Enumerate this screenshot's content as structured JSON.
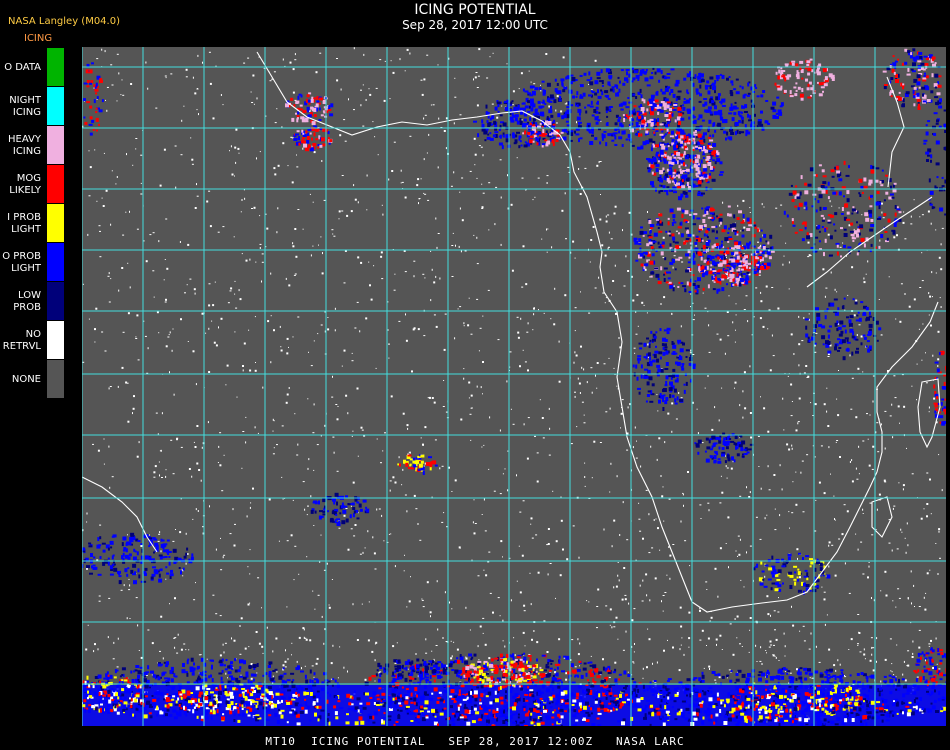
{
  "header": {
    "org": "NASA Langley (M04.0)",
    "variable": "ICING",
    "title": "ICING POTENTIAL",
    "datetime": "Sep 28, 2017 12:00 UTC"
  },
  "legend": [
    {
      "label": "O DATA",
      "color": "#00b400"
    },
    {
      "label": "NIGHT\nICING",
      "color": "#00ffff"
    },
    {
      "label": "HEAVY\nICING",
      "color": "#f0b0e0"
    },
    {
      "label": "MOG\nLIKELY",
      "color": "#ff0000"
    },
    {
      "label": "I PROB\nLIGHT",
      "color": "#ffff00"
    },
    {
      "label": "O PROB\nLIGHT",
      "color": "#0000ff"
    },
    {
      "label": "LOW\nPROB",
      "color": "#00007a"
    },
    {
      "label": "NO\nRETRVL",
      "color": "#ffffff"
    },
    {
      "label": "NONE",
      "color": "#555555"
    }
  ],
  "map": {
    "background_color": "#555555",
    "grid_color": "#44dddd",
    "label_color": "#cc2222"
  },
  "footer": "MT10  ICING POTENTIAL   SEP 28, 2017 12:00Z   NASA LARC"
}
